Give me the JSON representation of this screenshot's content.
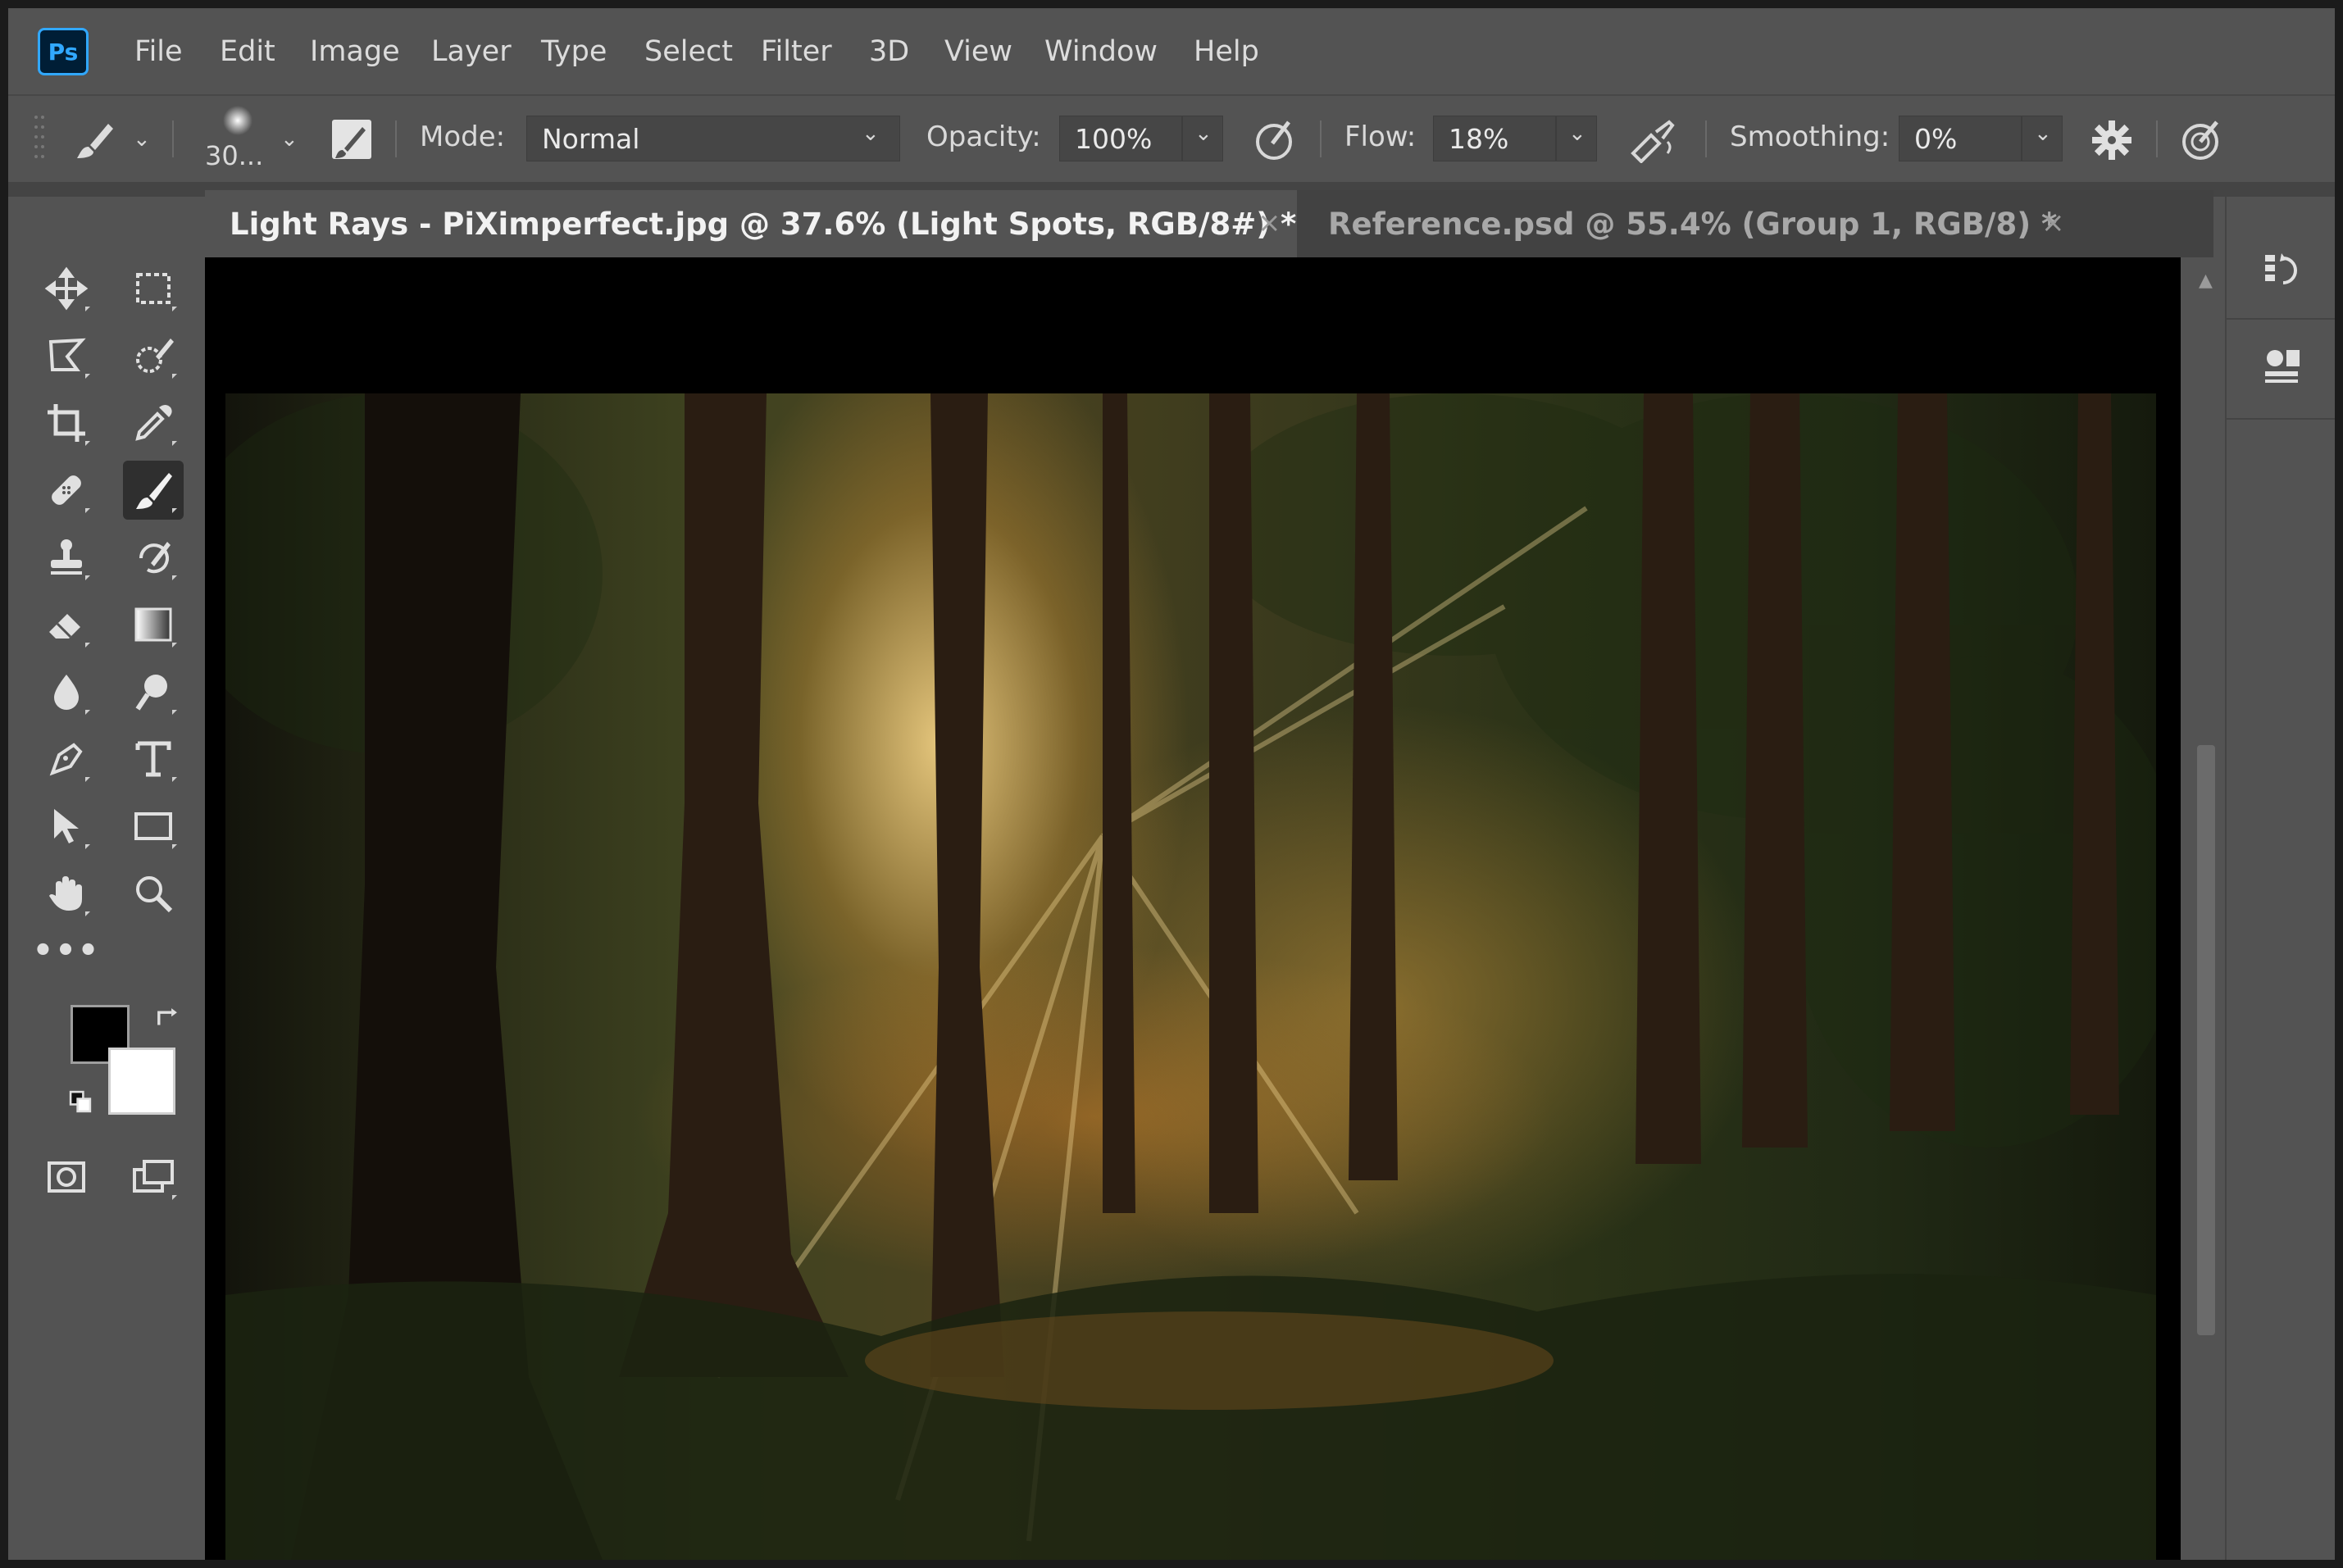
{
  "app": {
    "logo": "Ps"
  },
  "menu": [
    "File",
    "Edit",
    "Image",
    "Layer",
    "Type",
    "Select",
    "Filter",
    "3D",
    "View",
    "Window",
    "Help"
  ],
  "options": {
    "brush_size": "30...",
    "mode_label": "Mode:",
    "mode_value": "Normal",
    "opacity_label": "Opacity:",
    "opacity_value": "100%",
    "flow_label": "Flow:",
    "flow_value": "18%",
    "smoothing_label": "Smoothing:",
    "smoothing_value": "0%"
  },
  "tabs": [
    {
      "title": "Light Rays - PiXimperfect.jpg @ 37.6% (Light Spots, RGB/8#) *",
      "close": "×",
      "active": true
    },
    {
      "title": "Reference.psd @ 55.4% (Group 1, RGB/8) *",
      "close": "×",
      "active": false
    }
  ],
  "toolbar": {
    "tools": [
      "move-tool",
      "rectangular-marquee-tool",
      "lasso-tool",
      "quick-selection-tool",
      "crop-tool",
      "eyedropper-tool",
      "healing-brush-tool",
      "brush-tool",
      "clone-stamp-tool",
      "history-brush-tool",
      "eraser-tool",
      "gradient-tool",
      "blur-tool",
      "dodge-tool",
      "pen-tool",
      "type-tool",
      "path-selection-tool",
      "rectangle-tool",
      "hand-tool",
      "zoom-tool"
    ],
    "active_tool": "brush-tool",
    "more_tools": "•••",
    "foreground_color": "#000000",
    "background_color": "#ffffff"
  },
  "colors": {
    "ui_panel": "#535353",
    "ui_dark": "#424242",
    "active_tab": "#535353",
    "ps_blue": "#31a8ff",
    "ps_navy": "#001e36"
  }
}
